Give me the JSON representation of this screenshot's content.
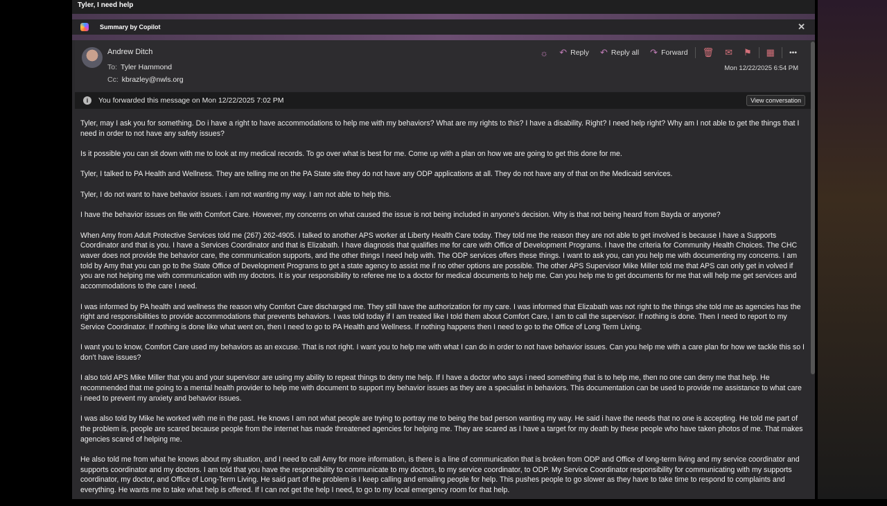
{
  "subject": "Tyler, I need help",
  "copilot": {
    "label": "Summary by Copilot"
  },
  "message": {
    "from": "Andrew Ditch",
    "to_label": "To:",
    "to": "Tyler Hammond",
    "cc_label": "Cc:",
    "cc": "kbrazley@nwls.org",
    "date": "Mon 12/22/2025 6:54 PM",
    "toolbar": {
      "reply": "Reply",
      "reply_all": "Reply all",
      "forward": "Forward"
    },
    "banner": "You forwarded this message on Mon 12/22/2025 7:02 PM",
    "view_conversation": "View conversation",
    "paragraphs": [
      "Tyler, may I ask you for something. Do i have a right to have accommodations to help me with my behaviors? What are my rights to this? I have a disability. Right? I need help right? Why am I not able to get the things that I need in order to not have any safety issues?",
      "Is it possible you can sit down with me to look at my medical records. To go over what is best for me. Come up with a plan on how we are going to get this done for me.",
      "Tyler, I talked to PA Health and Wellness. They are telling me on the PA State site they do not have any ODP applications at all. They do not have any of that on the Medicaid services.",
      "Tyler, I do not want to have behavior issues. i am not wanting my way. I am not able to help this.",
      "I have the behavior issues on file with Comfort Care. However, my concerns on what caused the issue is not being included in anyone's decision. Why is that not being heard from Bayda or anyone?",
      "When Amy from Adult Protective Services told me (267) 262-4905. I talked to another APS worker at Liberty Health Care today. They told me the reason they are not able to get involved is because I have a Supports Coordinator and that is you. I have a Services Coordinator and that is Elizabath. I have diagnosis that qualifies me for care with Office of Development Programs.  I have the criteria for Community Health Choices. The CHC waver does not provide the behavior care, the communication supports, and the other things I need help with. The ODP services offers these things. I want to ask you, can you help me with documenting my concerns. I am told by Amy that you can go to the State Office of Development Programs to get a state agency to assist me if no other options are possible. The other APS Supervisor Mike Miller told me that APS can only get in volved if you are not helping me with communication with my doctors. It is your responsibility to referee me to a doctor for medical documents to help me. Can you help me to get documents for me that will help me get services and accommodations to the care I need.",
      "I was informed by PA health and wellness the reason why Comfort Care discharged me. They still have the authorization for my care. I was informed that Elizabath was not right to the things she told me as agencies has the right and responsibilities to provide accommodations that prevents behaviors. I was told today if I am treated like I told them about Comfort Care, I am to call the supervisor. If nothing is done. Then I need to report to my Service Coordinator. If nothing is done like what went on, then I need to go to PA Health and Wellness. If nothing happens then I need to go to the Office of Long Term Living.",
      "I want you to know, Comfort Care used my behaviors as an excuse. That is not right. I want you to help me with what I can do in order to not have behavior issues. Can you help me with a care plan for how we tackle this so I don't have issues?",
      "I also told APS Mike Miller that you and your supervisor are using my ability to repeat things to deny me help. If I have a doctor who says i need something that is to help me, then no one can deny me that help. He recommended that me going to a mental health provider to help me with document to support my behavior issues as they are a specialist in behaviors. This documentation can be used to provide me assistance to what care i need to prevent my anxiety and behavior issues.",
      "I was also told by Mike he worked with me in the past. He knows I am not what people are trying to portray me to being the bad person wanting my way. He said i have the needs that no one is accepting. He told me part of the problem is, people are scared because people from the internet has made threatened agencies for helping me. They are scared as I have a target for my death by these people who have taken photos of me. That makes agencies scared of helping me.",
      "He also told me from what he knows about my situation, and I need to call Amy for more information, is there is a line of communication that is broken from ODP and Office of long-term living and my service coordinator and supports coordinator and my doctors. I am told that you have the responsibility to communicate to my doctors, to my service coordinator, to ODP. My Service Coordinator responsibility for communicating with my supports coordinator, my doctor, and Office of Long-Term Living. He said part of the problem is I keep calling and emailing people for help. This pushes people to go slower as they have to take time to respond to complaints and everything. He wants me to take what help is offered. If I can not get the help I need, to go to my local emergency room for that help."
    ]
  }
}
